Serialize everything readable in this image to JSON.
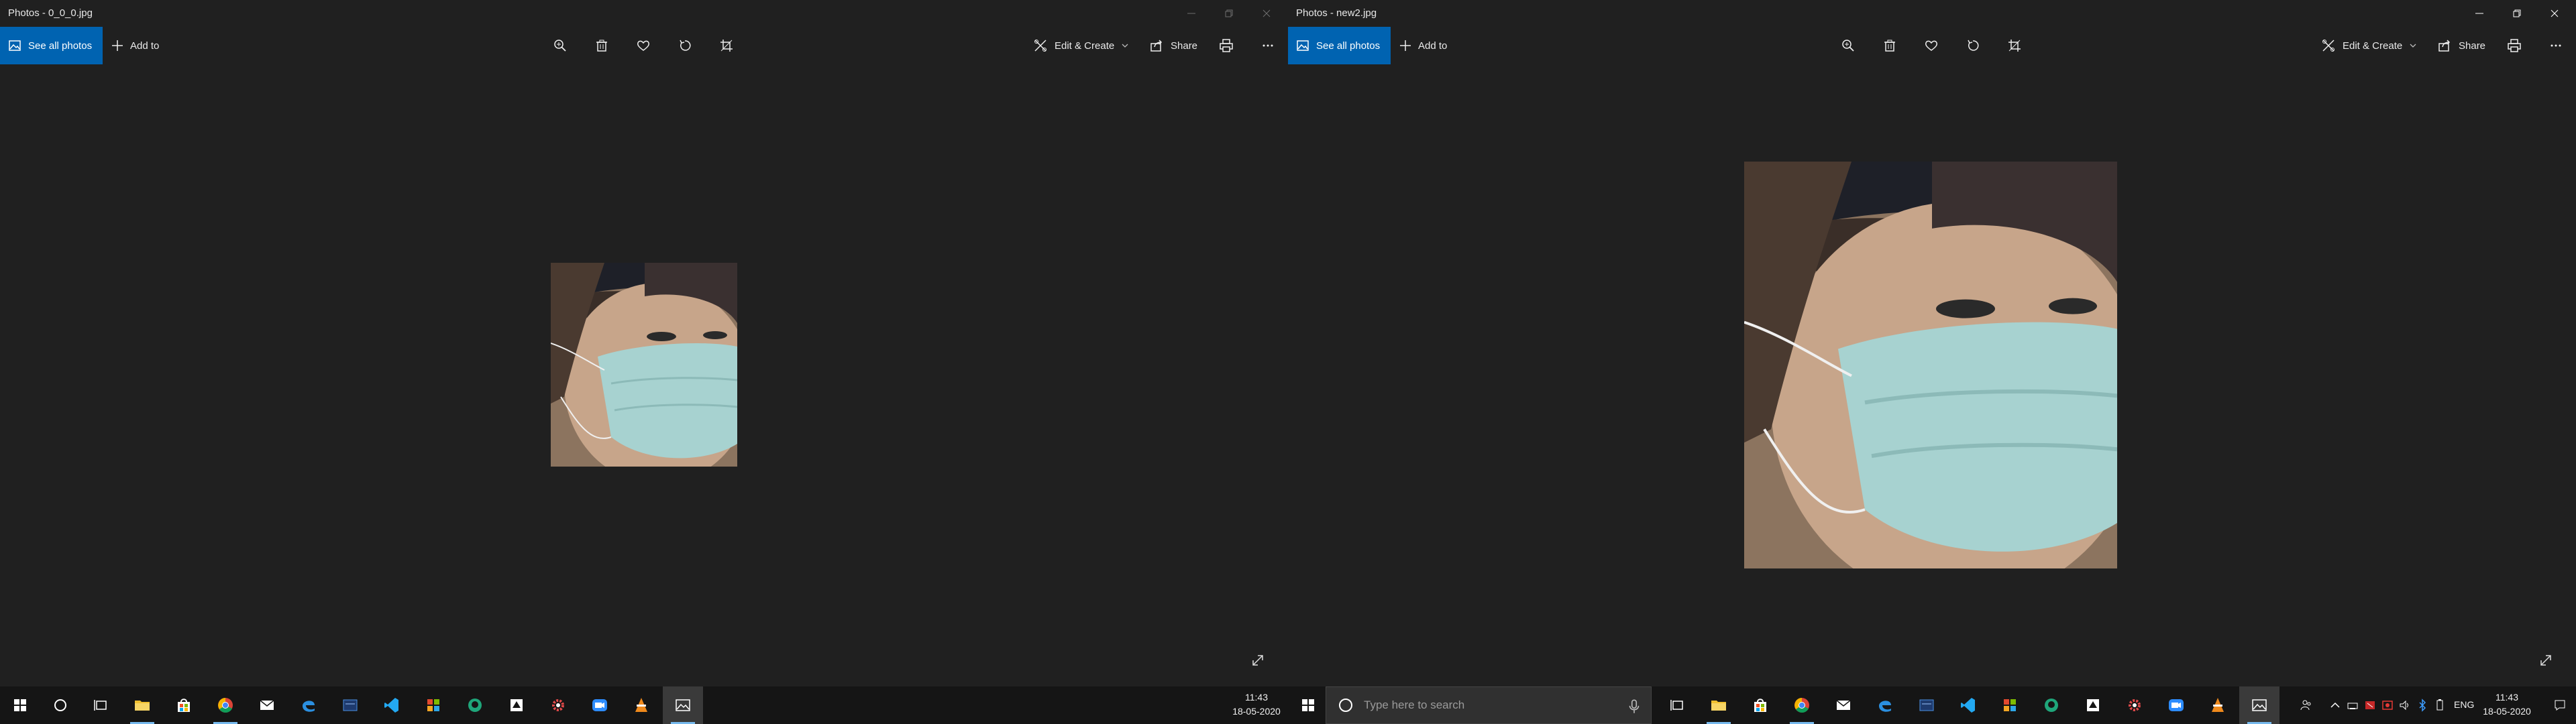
{
  "windows": [
    {
      "title": "Photos - 0_0_0.jpg",
      "see_all_label": "See all photos",
      "add_to_label": "Add to",
      "edit_create_label": "Edit & Create",
      "share_label": "Share",
      "active": false
    },
    {
      "title": "Photos - new2.jpg",
      "see_all_label": "See all photos",
      "add_to_label": "Add to",
      "edit_create_label": "Edit & Create",
      "share_label": "Share",
      "active": true
    }
  ],
  "toolbar_icons": [
    "zoom-icon",
    "delete-icon",
    "favorite-icon",
    "rotate-icon",
    "crop-icon",
    "print-icon",
    "more-icon"
  ],
  "taskbar": {
    "left_clock": {
      "time": "11:43",
      "date": "18-05-2020"
    },
    "right_clock": {
      "time": "11:43",
      "date": "18-05-2020"
    },
    "search_placeholder": "Type here to search",
    "language": "ENG",
    "apps": [
      "file-explorer",
      "store",
      "chrome",
      "mail",
      "edge",
      "photos-tool",
      "vscode",
      "office",
      "gitkraken",
      "unity",
      "settings",
      "zoom",
      "vlc",
      "photos"
    ]
  },
  "colors": {
    "accent": "#0063b1",
    "window_bg": "#202020",
    "taskbar_bg": "#151515"
  }
}
